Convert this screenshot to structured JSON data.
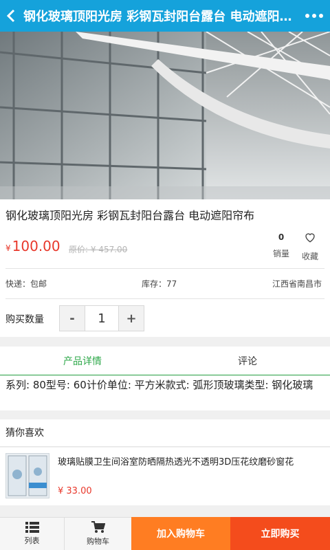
{
  "header": {
    "title": "钢化玻璃顶阳光房 彩钢瓦封阳台露台 电动遮阳帘布"
  },
  "product": {
    "name": "钢化玻璃顶阳光房 彩钢瓦封阳台露台 电动遮阳帘布",
    "currency": "¥",
    "price": "100.00",
    "original_price": "原价: ¥ 457.00",
    "sales_count": "0",
    "sales_label": "销量",
    "favorite_label": "收藏",
    "shipping": "快递：包邮",
    "stock": "库存：77",
    "location": "江西省南昌市",
    "quantity_label": "购买数量",
    "quantity": "1",
    "minus": "-",
    "plus": "+"
  },
  "tabs": [
    {
      "label": "产品详情",
      "active": true
    },
    {
      "label": "评论",
      "active": false
    }
  ],
  "detail_text": "系列: 80型号: 60计价单位: 平方米款式: 弧形顶玻璃类型: 钢化玻璃",
  "recommend": {
    "heading": "猜你喜欢",
    "items": [
      {
        "name": "玻璃贴膜卫生间浴室防晒隔热透光不透明3D压花纹磨砂窗花",
        "price": "¥ 33.00"
      }
    ]
  },
  "bottom": {
    "list_label": "列表",
    "cart_label": "购物车",
    "add_cart": "加入购物车",
    "buy_now": "立即购买"
  },
  "colors": {
    "topbar": "#15a2db",
    "price": "#e8372a",
    "tab_active": "#2ea84a",
    "add_cart": "#ff7d22",
    "buy_now": "#f44c1c"
  }
}
